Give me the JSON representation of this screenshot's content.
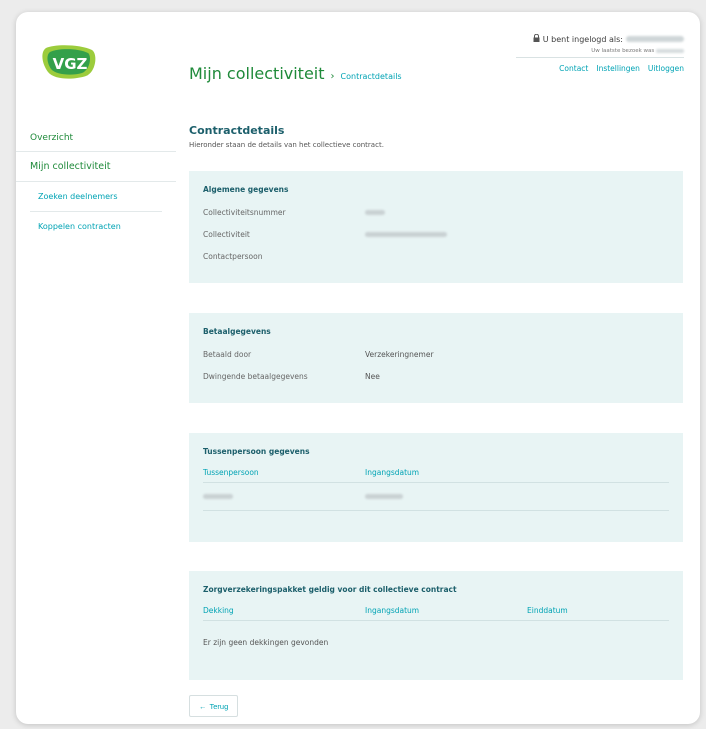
{
  "header": {
    "title": "Mijn collectiviteit",
    "separator": "›",
    "breadcrumb": "Contractdetails",
    "login_text": "U bent ingelogd als:",
    "last_visit_text": "Uw laatste bezoek was",
    "links": [
      "Contact",
      "Instellingen",
      "Uitloggen"
    ]
  },
  "sidebar": {
    "overzicht": "Overzicht",
    "mijn_collectiviteit": "Mijn collectiviteit",
    "sub_items": [
      "Zoeken deelnemers",
      "Koppelen contracten"
    ]
  },
  "content": {
    "title": "Contractdetails",
    "intro": "Hieronder staan de details van het collectieve contract."
  },
  "algemeen": {
    "title": "Algemene gegevens",
    "rows": [
      {
        "label": "Collectiviteitsnummer"
      },
      {
        "label": "Collectiviteit"
      },
      {
        "label": "Contactpersoon"
      }
    ]
  },
  "betaal": {
    "title": "Betaalgegevens",
    "rows": [
      {
        "label": "Betaald door",
        "value": "Verzekeringnemer"
      },
      {
        "label": "Dwingende betaalgegevens",
        "value": "Nee"
      }
    ]
  },
  "tussen": {
    "title": "Tussenpersoon gegevens",
    "headers": [
      "Tussenpersoon",
      "Ingangsdatum"
    ]
  },
  "zorg": {
    "title": "Zorgverzekeringspakket geldig voor dit collectieve contract",
    "headers": [
      "Dekking",
      "Ingangsdatum",
      "Einddatum"
    ],
    "empty": "Er zijn geen dekkingen gevonden"
  },
  "back": {
    "arrow": "←",
    "label": "Terug"
  },
  "colors": {
    "brand_green": "#1f8a3a",
    "brand_teal": "#00a3b4",
    "card_bg": "#e8f4f4",
    "title_dark": "#1c5f6b"
  },
  "icons": {
    "logo": "vgz-logo",
    "lock": "lock-icon"
  }
}
